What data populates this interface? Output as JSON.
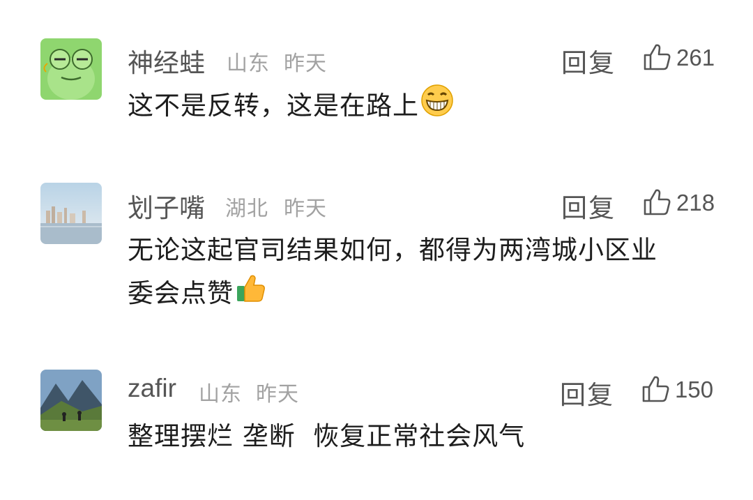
{
  "comments": [
    {
      "username": "神经蛙",
      "location": "山东",
      "time": "昨天",
      "reply_label": "回复",
      "likes": "261",
      "text_lines": [
        "这不是反转，这是在路上"
      ],
      "avatar_icon": "frog-avatar-icon",
      "emoji": "grinning-face-icon"
    },
    {
      "username": "划子嘴",
      "location": "湖北",
      "time": "昨天",
      "reply_label": "回复",
      "likes": "218",
      "text_lines": [
        "无论这起官司结果如何，都得为两湾城小区业",
        "委会点赞"
      ],
      "avatar_icon": "city-skyline-avatar-icon",
      "emoji": "thumbs-up-icon"
    },
    {
      "username": "zafir",
      "location": "山东",
      "time": "昨天",
      "reply_label": "回复",
      "likes": "150",
      "text_lines": [
        "整理摆烂 垄断  恢复正常社会风气"
      ],
      "avatar_icon": "mountain-landscape-avatar-icon"
    }
  ],
  "colors": {
    "username": "#555555",
    "meta": "#a2a2a2",
    "text": "#1d1d1d"
  }
}
